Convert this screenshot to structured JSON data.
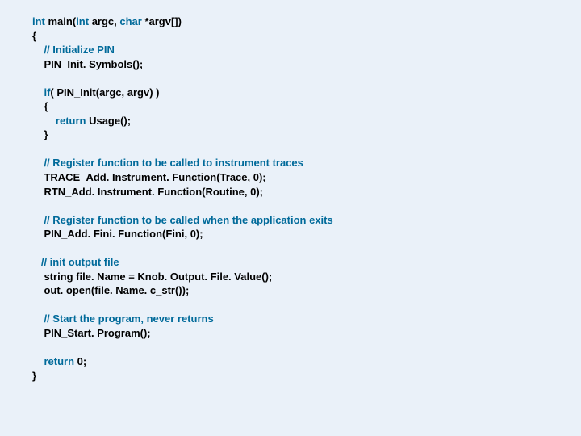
{
  "code": {
    "l1_kw1": "int",
    "l1_txt1": " main(",
    "l1_kw2": "int",
    "l1_txt2": " argc, ",
    "l1_kw3": "char",
    "l1_txt3": " *argv[])",
    "l2": "{",
    "l3_cm": "    // Initialize PIN",
    "l4": "    PIN_Init. Symbols();",
    "blank1": " ",
    "l5_p1": "    ",
    "l5_kw": "if",
    "l5_p2": "( PIN_Init(argc, argv) )",
    "l6": "    {",
    "l7_p1": "        ",
    "l7_kw": "return",
    "l7_p2": " Usage();",
    "l8": "    }",
    "blank2": " ",
    "l9_cm": "    // Register function to be called to instrument traces",
    "l10": "    TRACE_Add. Instrument. Function(Trace, 0);",
    "l11": "    RTN_Add. Instrument. Function(Routine, 0);",
    "blank3": " ",
    "l12_cm": "    // Register function to be called when the application exits",
    "l13": "    PIN_Add. Fini. Function(Fini, 0);",
    "blank4": " ",
    "l14_cm": "   // init output file",
    "l15": "    string file. Name = Knob. Output. File. Value();",
    "l16": "    out. open(file. Name. c_str());",
    "blank5": " ",
    "l17_cm": "    // Start the program, never returns",
    "l18": "    PIN_Start. Program();",
    "blank6": " ",
    "l19_p1": "    ",
    "l19_kw": "return",
    "l19_p2": " 0;",
    "l20": "}"
  }
}
